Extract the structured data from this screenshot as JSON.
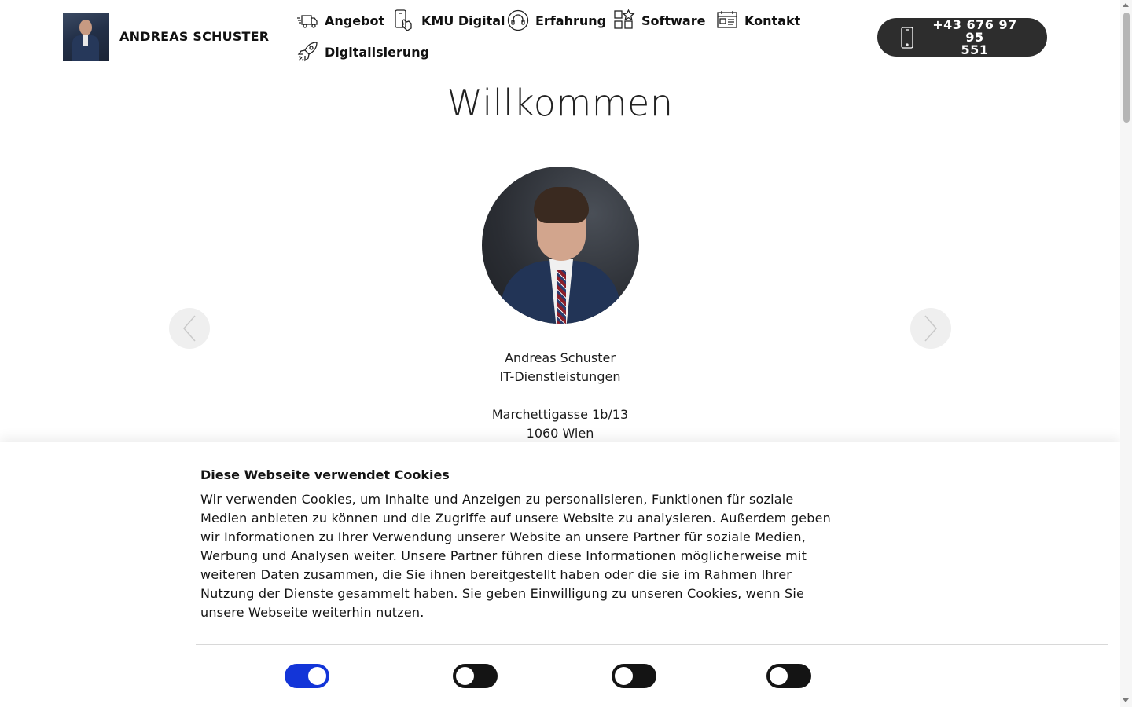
{
  "header": {
    "brand": "ANDREAS SCHUSTER",
    "nav": [
      {
        "label": "Angebot",
        "icon": "delivery-truck-icon"
      },
      {
        "label": "KMU Digital",
        "icon": "touch-phone-icon"
      },
      {
        "label": "Erfahrung",
        "icon": "headset-icon"
      },
      {
        "label": "Software",
        "icon": "app-grid-icon"
      },
      {
        "label": "Kontakt",
        "icon": "calendar-card-icon"
      },
      {
        "label": "Digitalisierung",
        "icon": "rocket-icon"
      }
    ],
    "phone": {
      "line1": "+43 676 97 95",
      "line2": "551",
      "icon": "smartphone-icon"
    }
  },
  "main": {
    "headline": "Willkommen",
    "address": {
      "name": "Andreas Schuster",
      "title": "IT-Dienstleistungen",
      "street": "Marchettigasse 1b/13",
      "city": "1060 Wien"
    }
  },
  "cookie": {
    "title": "Diese Webseite verwendet Cookies",
    "text": "Wir verwenden Cookies, um Inhalte und Anzeigen zu personalisieren, Funktionen für soziale Medien anbieten zu können und die Zugriffe auf unsere Website zu analysieren. Außerdem geben wir Informationen zu Ihrer Verwendung unserer Website an unsere Partner für soziale Medien, Werbung und Analysen weiter. Unsere Partner führen diese Informationen möglicherweise mit weiteren Daten zusammen, die Sie ihnen bereitgestellt haben oder die sie im Rahmen Ihrer Nutzung der Dienste gesammelt haben. Sie geben Einwilligung zu unseren Cookies, wenn Sie unsere Webseite weiterhin nutzen.",
    "toggles": [
      true,
      false,
      false,
      false
    ]
  },
  "colors": {
    "accent": "#1335d8",
    "dark": "#2d2d2d"
  }
}
